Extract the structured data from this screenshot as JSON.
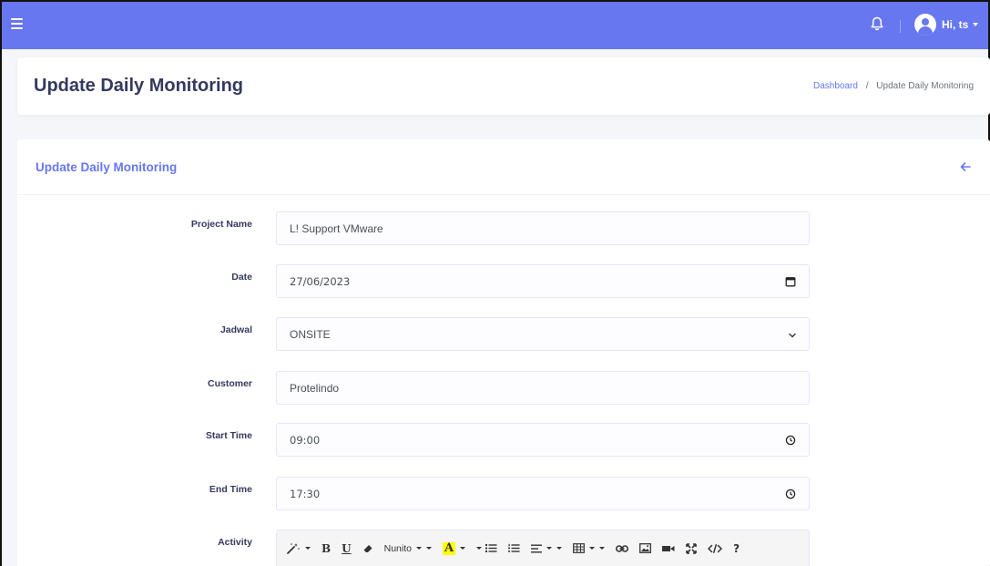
{
  "topbar": {
    "user_greeting": "Hi, ts"
  },
  "header": {
    "title": "Update Daily Monitoring",
    "breadcrumb": {
      "home": "Dashboard",
      "separator": "/",
      "current": "Update Daily Monitoring"
    }
  },
  "card": {
    "title": "Update Daily Monitoring"
  },
  "form": {
    "project_name": {
      "label": "Project Name",
      "value": "L! Support VMware"
    },
    "date": {
      "label": "Date",
      "value": "27/06/2023"
    },
    "jadwal": {
      "label": "Jadwal",
      "value": "ONSITE"
    },
    "customer": {
      "label": "Customer",
      "value": "Protelindo"
    },
    "start_time": {
      "label": "Start Time",
      "value": "09:00"
    },
    "end_time": {
      "label": "End Time",
      "value": "17:30"
    },
    "activity": {
      "label": "Activity"
    }
  },
  "editor_toolbar": {
    "font_name": "Nunito",
    "bold": "B",
    "underline": "U",
    "highlight": "A",
    "help": "?"
  },
  "colors": {
    "primary": "#6777ef",
    "title_text": "#34395e",
    "background": "#f4f6f9"
  }
}
